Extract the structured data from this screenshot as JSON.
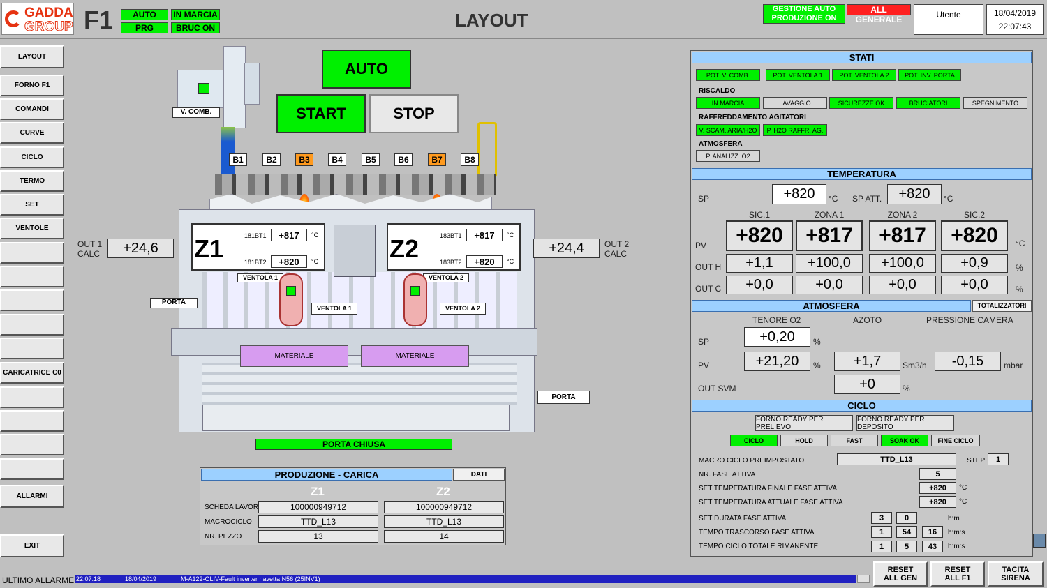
{
  "header": {
    "logo_top": "GADDA",
    "logo_bottom": "GROUP",
    "furnace": "F1",
    "status": [
      "AUTO",
      "IN MARCIA",
      "PRG",
      "BRUC ON"
    ],
    "title": "LAYOUT",
    "gestione_auto": "GESTIONE AUTO",
    "produzione_on": "PRODUZIONE ON",
    "all_generale": "ALL GENERALE",
    "user": "Utente",
    "date": "18/04/2019",
    "time": "22:07:43"
  },
  "sidebar": {
    "items": [
      "LAYOUT",
      "FORNO F1",
      "COMANDI",
      "CURVE",
      "CICLO",
      "TERMO",
      "SET",
      "VENTOLE",
      "",
      "",
      "",
      "",
      "",
      "CARICATRICE C0",
      "",
      "",
      "",
      "",
      "ALLARMI",
      "EXIT"
    ]
  },
  "controls": {
    "auto": "AUTO",
    "start": "START",
    "stop": "STOP"
  },
  "layout": {
    "vcomb": "V. COMB.",
    "burners": [
      "B1",
      "B2",
      "B3",
      "B4",
      "B5",
      "B6",
      "B7",
      "B8"
    ],
    "burners_on": [
      false,
      false,
      true,
      false,
      false,
      false,
      true,
      false
    ],
    "z1": {
      "name": "Z1",
      "t1_label": "181BT1",
      "t1": "+817",
      "t2_label": "181BT2",
      "t2": "+820",
      "unit": "°C"
    },
    "z2": {
      "name": "Z2",
      "t1_label": "183BT1",
      "t1": "+817",
      "t2_label": "183BT2",
      "t2": "+820",
      "unit": "°C"
    },
    "out1_label": "OUT 1",
    "out1_calc": "CALC",
    "out1": "+24,6",
    "out2_label": "OUT 2",
    "out2_calc": "CALC",
    "out2": "+24,4",
    "ventola1": "VENTOLA 1",
    "ventola2": "VENTOLA 2",
    "porta": "PORTA",
    "materiale": "MATERIALE",
    "porta_chiusa": "PORTA CHIUSA"
  },
  "produzione": {
    "title": "PRODUZIONE - CARICA",
    "dati": "DATI",
    "z1": "Z1",
    "z2": "Z2",
    "rows": [
      {
        "label": "SCHEDA LAVORO",
        "z1": "100000949712",
        "z2": "100000949712"
      },
      {
        "label": "MACROCICLO",
        "z1": "TTD_L13",
        "z2": "TTD_L13"
      },
      {
        "label": "NR. PEZZO",
        "z1": "13",
        "z2": "14"
      }
    ]
  },
  "stati": {
    "title": "STATI",
    "top": [
      "POT. V. COMB.",
      "POT. VENTOLA 1",
      "POT. VENTOLA 2",
      "POT. INV. PORTA"
    ],
    "riscaldo": "RISCALDO",
    "riscaldo_items": [
      "IN MARCIA",
      "LAVAGGIO",
      "SICUREZZE OK",
      "BRUCIATORI",
      "SPEGNIMENTO"
    ],
    "raffr": "RAFFREDDAMENTO AGITATORI",
    "raffr_items": [
      "V. SCAM. ARIA/H2O",
      "P. H2O RAFFR. AG."
    ],
    "atmosfera": "ATMOSFERA",
    "atm_items": [
      "P. ANALIZZ. O2"
    ]
  },
  "temperatura": {
    "title": "TEMPERATURA",
    "sp_label": "SP",
    "sp": "+820",
    "unit": "°C",
    "spatt_label": "SP ATT.",
    "spatt": "+820",
    "cols": [
      "SIC.1",
      "ZONA 1",
      "ZONA 2",
      "SIC.2"
    ],
    "pv_label": "PV",
    "pv": [
      "+820",
      "+817",
      "+817",
      "+820"
    ],
    "outh_label": "OUT H",
    "outh": [
      "+1,1",
      "+100,0",
      "+100,0",
      "+0,9"
    ],
    "outc_label": "OUT C",
    "outc": [
      "+0,0",
      "+0,0",
      "+0,0",
      "+0,0"
    ],
    "pct": "%"
  },
  "atmos": {
    "title": "ATMOSFERA",
    "totalizzatori": "TOTALIZZATORI",
    "cols": [
      "TENORE O2",
      "AZOTO",
      "PRESSIONE CAMERA"
    ],
    "sp_label": "SP",
    "sp": "+0,20",
    "pv_label": "PV",
    "pv_o2": "+21,20",
    "pv_az": "+1,7",
    "pv_pc": "-0,15",
    "out_label": "OUT SVM",
    "out": "+0",
    "pct": "%",
    "sm3h": "Sm3/h",
    "mbar": "mbar"
  },
  "ciclo": {
    "title": "CICLO",
    "ready1": "FORNO READY PER PRELIEVO",
    "ready2": "FORNO READY PER DEPOSITO",
    "tabs": [
      "CICLO",
      "HOLD",
      "FAST",
      "SOAK OK",
      "FINE CICLO"
    ],
    "macro_label": "MACRO CICLO PREIMPOSTATO",
    "macro": "TTD_L13",
    "step_label": "STEP",
    "step": "1",
    "fase_label": "NR. FASE ATTIVA",
    "fase": "5",
    "setfin_label": "SET TEMPERATURA FINALE FASE ATTIVA",
    "setfin": "+820",
    "setatt_label": "SET TEMPERATURA ATTUALE FASE ATTIVA",
    "setatt": "+820",
    "unit": "°C",
    "dur_label": "SET DURATA FASE ATTIVA",
    "dur_h": "3",
    "dur_m": "0",
    "hm": "h:m",
    "tr_label": "TEMPO TRASCORSO FASE ATTIVA",
    "tr_h": "1",
    "tr_m": "54",
    "tr_s": "16",
    "hms": "h:m:s",
    "rim_label": "TEMPO CICLO TOTALE RIMANENTE",
    "rim_h": "1",
    "rim_m": "5",
    "rim_s": "43"
  },
  "footer": {
    "ultimo": "ULTIMO ALLARME",
    "time": "22:07:18",
    "date": "18/04/2019",
    "msg": "M-A122-OLIV-Fault inverter navetta N56 (25INV1)",
    "reset_gen": [
      "RESET",
      "ALL GEN"
    ],
    "reset_f1": [
      "RESET",
      "ALL F1"
    ],
    "tacita": [
      "TACITA",
      "SIRENA"
    ]
  }
}
